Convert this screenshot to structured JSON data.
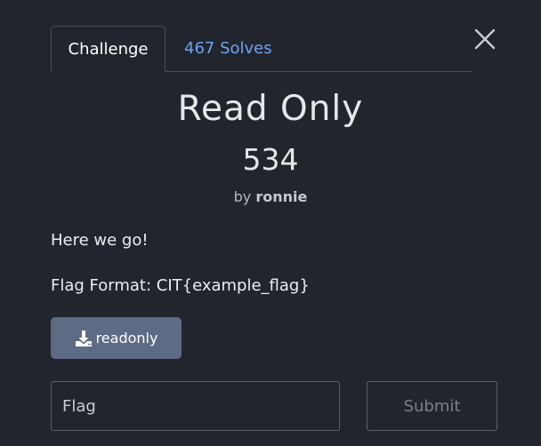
{
  "tabs": [
    {
      "label": "Challenge",
      "active": true
    },
    {
      "label": "467 Solves",
      "active": false
    }
  ],
  "challenge": {
    "title": "Read Only",
    "points": "534",
    "author_prefix": "by",
    "author_name": "ronnie",
    "description": [
      "Here we go!",
      "Flag Format: CIT{example_flag}"
    ]
  },
  "files": [
    {
      "label": "readonly",
      "icon": "download-icon"
    }
  ],
  "flag_input": {
    "placeholder": "Flag",
    "value": ""
  },
  "submit": {
    "label": "Submit"
  },
  "colors": {
    "background": "#22252e",
    "link": "#6fa3ef",
    "file_button": "#5d6b84"
  },
  "icons": {
    "close": "close-icon",
    "download": "download-icon"
  }
}
